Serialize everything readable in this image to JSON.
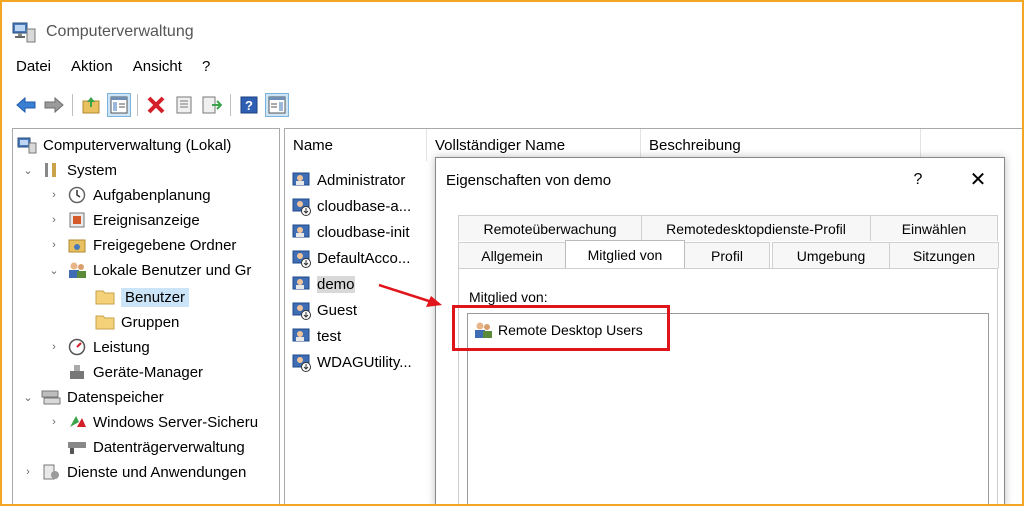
{
  "window": {
    "title": "Computerverwaltung"
  },
  "menu": {
    "items": [
      "Datei",
      "Aktion",
      "Ansicht",
      "?"
    ]
  },
  "toolbar": {
    "buttons": [
      "back-arrow-icon",
      "forward-arrow-icon",
      "up-folder-icon",
      "show-hide-tree-icon",
      "delete-icon",
      "properties-icon",
      "export-list-icon",
      "help-icon",
      "action-pane-icon"
    ]
  },
  "tree": {
    "root": "Computerverwaltung (Lokal)",
    "system": "System",
    "aufgaben": "Aufgabenplanung",
    "ereignis": "Ereignisanzeige",
    "freigabe": "Freigegebene Ordner",
    "lokale": "Lokale Benutzer und Gr",
    "benutzer": "Benutzer",
    "gruppen": "Gruppen",
    "leistung": "Leistung",
    "geraete": "Geräte-Manager",
    "datenspeicher": "Datenspeicher",
    "wsb": "Windows Server-Sicheru",
    "dtv": "Datenträgerverwaltung",
    "dienste": "Dienste und Anwendungen"
  },
  "list": {
    "columns": [
      "Name",
      "Vollständiger Name",
      "Beschreibung"
    ],
    "rows": [
      "Administrator",
      "cloudbase-a...",
      "cloudbase-init",
      "DefaultAcco...",
      "demo",
      "Guest",
      "test",
      "WDAGUtility..."
    ]
  },
  "dialog": {
    "title": "Eigenschaften von demo",
    "help": "?",
    "close": "✕",
    "tabs_top": [
      "Remoteüberwachung",
      "Remotedesktopdienste-Profil",
      "Einwählen"
    ],
    "tabs_bottom": [
      "Allgemein",
      "Mitglied von",
      "Profil",
      "Umgebung",
      "Sitzungen"
    ],
    "member_label": "Mitglied von:",
    "members": [
      "Remote Desktop Users"
    ]
  },
  "colors": {
    "frame": "#f5a623",
    "highlight": "#e0151c",
    "selection": "#cce4f7"
  }
}
